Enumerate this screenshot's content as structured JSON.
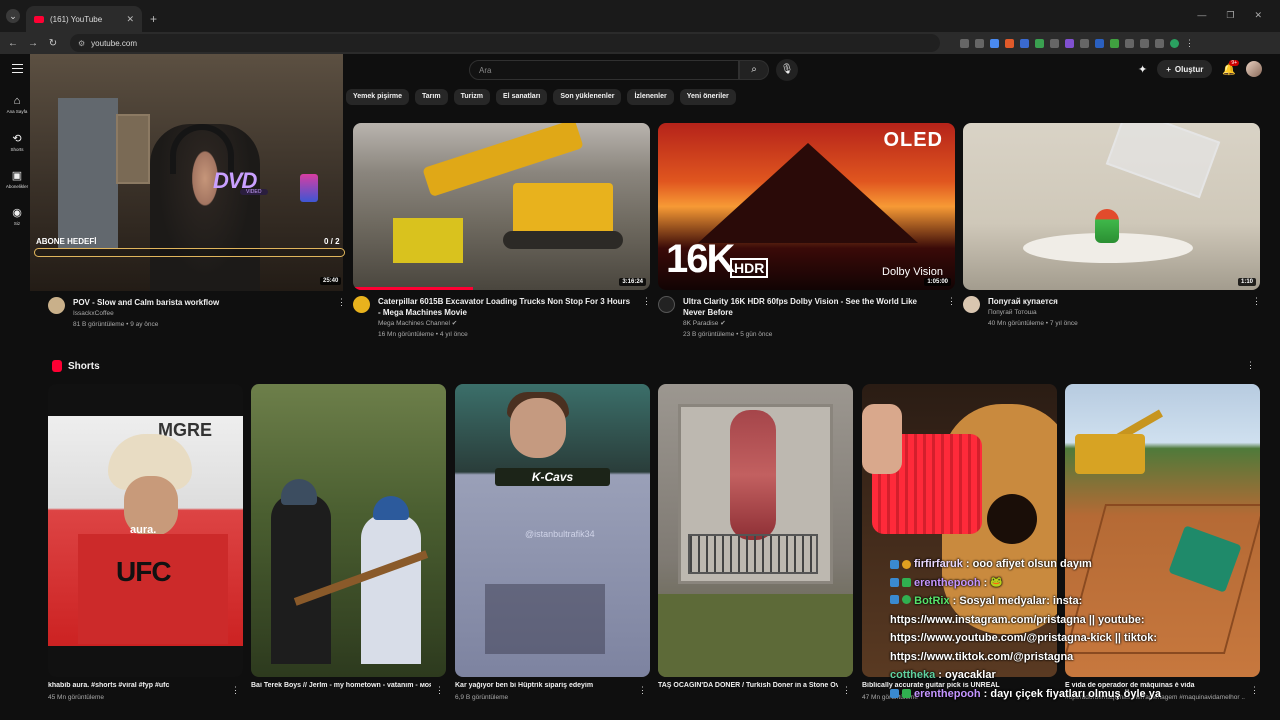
{
  "browser": {
    "tab_title": "(161) YouTube",
    "url": "youtube.com"
  },
  "header": {
    "search_placeholder": "Ara",
    "create_label": "Oluştur",
    "notification_count": "9+"
  },
  "sidebar": {
    "items": [
      {
        "label": "Ana Sayfa",
        "icon": "home-icon"
      },
      {
        "label": "Shorts",
        "icon": "shorts-icon"
      },
      {
        "label": "Abonelikler",
        "icon": "subscriptions-icon"
      },
      {
        "label": "Siz",
        "icon": "user-icon"
      }
    ]
  },
  "chips": [
    "Yemek pişirme",
    "Tarım",
    "Turizm",
    "El sanatları",
    "Son yüklenenler",
    "İzlenenler",
    "Yeni öneriler"
  ],
  "overlay": {
    "dvd_logo": "DVD",
    "dvd_sub": "VIDEO",
    "goal_label": "ABONE HEDEFİ",
    "goal_count": "0 / 2"
  },
  "videos": [
    {
      "title": "POV - Slow and Calm barista workflow",
      "channel": "IssackxCoffee",
      "stats": "81 B görüntüleme • 9 ay önce",
      "duration": "25:40",
      "avatar_color": "#c9b08a"
    },
    {
      "title": "Caterpillar 6015B Excavator Loading Trucks Non Stop For 3 Hours - Mega Machines Movie",
      "channel": "Mega Machines Channel",
      "stats": "16 Mn görüntüleme • 4 yıl önce",
      "duration": "3:16:24",
      "avatar_color": "#e8b21d"
    },
    {
      "title": "Ultra Clarity 16K HDR 60fps Dolby Vision - See the World Like Never Before",
      "channel": "8K Paradise",
      "stats": "23 B görüntüleme • 5 gün önce",
      "duration": "1:05:00",
      "thumb_oled": "OLED",
      "thumb_16k": "16K",
      "thumb_hdr": "HDR",
      "thumb_dolby": "Dolby Vision",
      "avatar_color": "#222222"
    },
    {
      "title": "Попугай купается",
      "channel": "Попугай Тотоша",
      "stats": "40 Mn görüntüleme • 7 yıl önce",
      "duration": "1:10",
      "avatar_color": "#d9c6b0"
    }
  ],
  "shorts": {
    "section_title": "Shorts",
    "items": [
      {
        "title": "khabib aura. #shorts #viral #fyp #ufc",
        "views": "45 Mn görüntüleme",
        "overlay_text": "aura.",
        "shirt_text": "UFC",
        "sign_text": "MGRE"
      },
      {
        "title": "Bai Terek Boys // Jerlm - my hometown - vatanım - моя родина #altai #music #folk ...",
        "views": ""
      },
      {
        "title": "Kar yağıyor ben bi Hüptrik sipariş edeyim",
        "views": "6,9 B görüntüleme",
        "overlay_brand": "K-Cavs",
        "watermark": "@istanbultrafik34"
      },
      {
        "title": "TAŞ OCAĞIN'DA DÖNER / Turkish Doner in a Stone Oven / #t.g.g",
        "views": ""
      },
      {
        "title": "Biblically accurate guitar pick is UNREAL",
        "views": "47 Mn görüntüleme"
      },
      {
        "title": "E vida de operador de máquinas é vida",
        "views": "#operadordemaquinas #terraplenagem #maquinavidamelhor ..."
      }
    ]
  },
  "chat": [
    {
      "user": "firfirfaruk",
      "message": ": ooo afiyet olsun dayım"
    },
    {
      "user": "erenthepooh",
      "message": ":"
    },
    {
      "user": "BotRix",
      "message": ": Sosyal medyalar: insta: https://www.instagram.com/pristagna || youtube: https://www.youtube.com/@pristagna-kick || tiktok: https://www.tiktok.com/@pristagna"
    },
    {
      "user": "cottheka",
      "message": ": oyacaklar"
    },
    {
      "user": "erenthepooh",
      "message": ": dayı çiçek fiyatları olmuş öyle ya"
    }
  ],
  "colors": {
    "accent": "#ff0033",
    "background": "#0f0f0f"
  }
}
